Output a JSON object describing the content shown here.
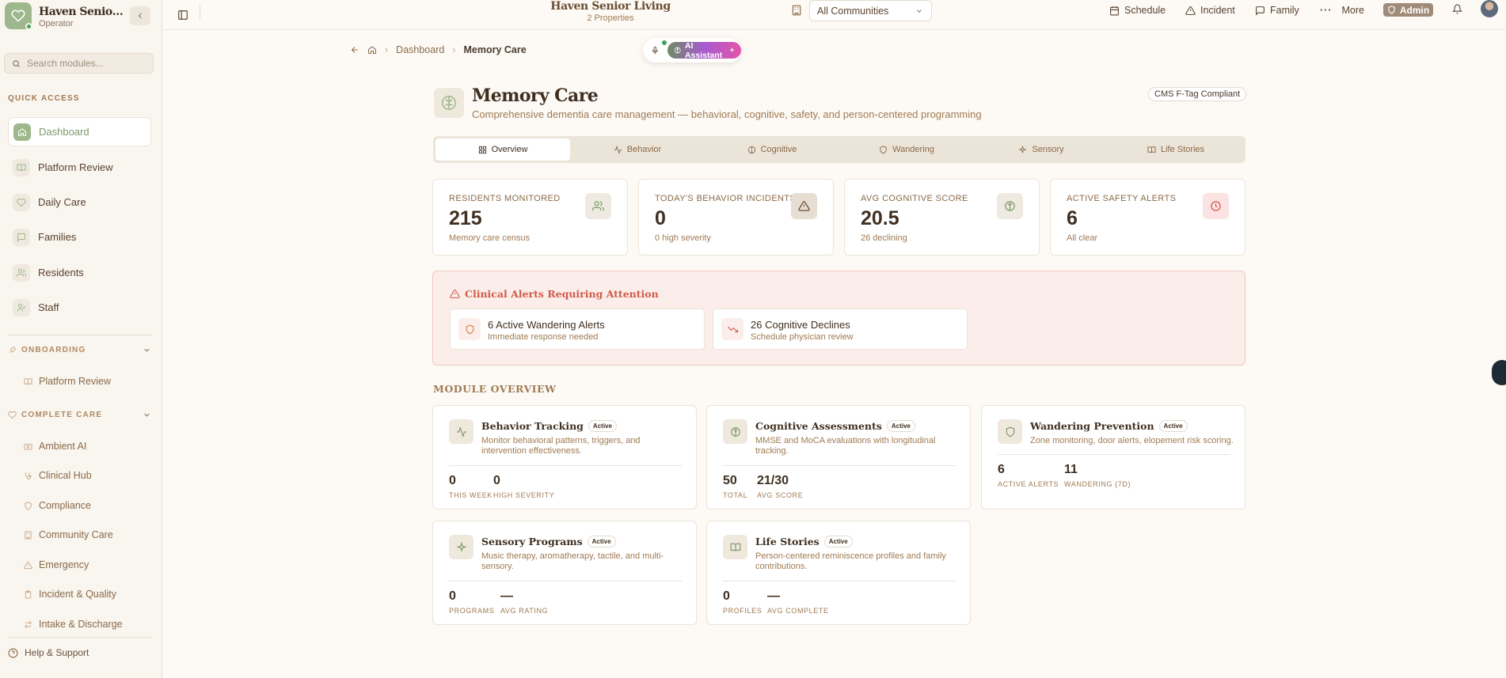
{
  "brand": {
    "name": "Haven Senior Living",
    "role": "Operator"
  },
  "search": {
    "placeholder": "Search modules..."
  },
  "quick_access": {
    "label": "QUICK ACCESS",
    "items": [
      {
        "label": "Dashboard",
        "icon": "home-icon",
        "active": true
      },
      {
        "label": "Platform Review",
        "icon": "book-icon"
      },
      {
        "label": "Daily Care",
        "icon": "heart-icon"
      },
      {
        "label": "Families",
        "icon": "message-icon"
      },
      {
        "label": "Residents",
        "icon": "users-icon"
      },
      {
        "label": "Staff",
        "icon": "user-check-icon"
      }
    ]
  },
  "onboarding": {
    "label": "ONBOARDING",
    "items": [
      {
        "label": "Platform Review",
        "icon": "book-icon"
      }
    ]
  },
  "complete_care": {
    "label": "COMPLETE CARE",
    "items": [
      {
        "label": "Ambient AI",
        "icon": "camera-icon"
      },
      {
        "label": "Clinical Hub",
        "icon": "stethoscope-icon"
      },
      {
        "label": "Compliance",
        "icon": "shield-icon"
      },
      {
        "label": "Community Care",
        "icon": "building-icon"
      },
      {
        "label": "Emergency",
        "icon": "alert-icon"
      },
      {
        "label": "Incident & Quality",
        "icon": "clipboard-icon"
      },
      {
        "label": "Intake & Discharge",
        "icon": "swap-icon"
      }
    ]
  },
  "help": {
    "label": "Help & Support"
  },
  "topbar": {
    "title": "Haven Senior Living",
    "subtitle": "2 Properties",
    "community_select": "All Communities",
    "schedule": "Schedule",
    "incident": "Incident",
    "family": "Family",
    "more": "More",
    "admin": "Admin"
  },
  "breadcrumb": {
    "parent": "Dashboard",
    "current": "Memory Care"
  },
  "ai": {
    "label": "AI Assistant"
  },
  "page": {
    "title": "Memory Care",
    "description": "Comprehensive dementia care management — behavioral, cognitive, safety, and person-centered programming",
    "badge": "CMS F-Tag Compliant"
  },
  "tabs": [
    {
      "label": "Overview",
      "icon": "grid-icon",
      "active": true
    },
    {
      "label": "Behavior",
      "icon": "activity-icon"
    },
    {
      "label": "Cognitive",
      "icon": "brain-icon"
    },
    {
      "label": "Wandering",
      "icon": "shield-icon"
    },
    {
      "label": "Sensory",
      "icon": "sparkle-icon"
    },
    {
      "label": "Life Stories",
      "icon": "book-icon"
    }
  ],
  "stats": [
    {
      "label": "RESIDENTS MONITORED",
      "value": "215",
      "sub": "Memory care census",
      "icon": "users-icon",
      "bg": "#efeae1",
      "color": "#7e9a6a"
    },
    {
      "label": "TODAY'S BEHAVIOR INCIDENTS",
      "value": "0",
      "sub": "0 high severity",
      "icon": "warning-icon",
      "bg": "#e6ded2",
      "color": "#6b4e32"
    },
    {
      "label": "AVG COGNITIVE SCORE",
      "value": "20.5",
      "sub": "26 declining",
      "icon": "brain-icon",
      "bg": "#efeae1",
      "color": "#7e9a6a"
    },
    {
      "label": "ACTIVE SAFETY ALERTS",
      "value": "6",
      "sub": "All clear",
      "icon": "clock-icon",
      "bg": "#fbe3e3",
      "color": "#d9534f"
    }
  ],
  "alerts": {
    "title": "Clinical Alerts Requiring Attention",
    "items": [
      {
        "main": "6 Active Wandering Alerts",
        "sub": "Immediate response needed",
        "icon": "shield-icon"
      },
      {
        "main": "26 Cognitive Declines",
        "sub": "Schedule physician review",
        "icon": "trending-down-icon"
      }
    ]
  },
  "module_overview": {
    "title": "MODULE OVERVIEW",
    "badge": "Active",
    "modules": [
      {
        "title": "Behavior Tracking",
        "desc": "Monitor behavioral patterns, triggers, and intervention effectiveness.",
        "icon": "activity-icon",
        "stats": [
          {
            "value": "0",
            "label": "THIS WEEK"
          },
          {
            "value": "0",
            "label": "HIGH SEVERITY"
          }
        ]
      },
      {
        "title": "Cognitive Assessments",
        "desc": "MMSE and MoCA evaluations with longitudinal tracking.",
        "icon": "brain-icon",
        "stats": [
          {
            "value": "50",
            "label": "TOTAL"
          },
          {
            "value": "21/30",
            "label": "AVG SCORE"
          }
        ]
      },
      {
        "title": "Wandering Prevention",
        "desc": "Zone monitoring, door alerts, elopement risk scoring.",
        "icon": "shield-icon",
        "stats": [
          {
            "value": "6",
            "label": "ACTIVE ALERTS"
          },
          {
            "value": "11",
            "label": "WANDERING (7D)"
          }
        ]
      },
      {
        "title": "Sensory Programs",
        "desc": "Music therapy, aromatherapy, tactile, and multi-sensory.",
        "icon": "sparkle-icon",
        "stats": [
          {
            "value": "0",
            "label": "PROGRAMS"
          },
          {
            "value": "—",
            "label": "AVG RATING"
          }
        ]
      },
      {
        "title": "Life Stories",
        "desc": "Person-centered reminiscence profiles and family contributions.",
        "icon": "book-icon",
        "stats": [
          {
            "value": "0",
            "label": "PROFILES"
          },
          {
            "value": "—",
            "label": "AVG COMPLETE"
          }
        ]
      }
    ]
  }
}
